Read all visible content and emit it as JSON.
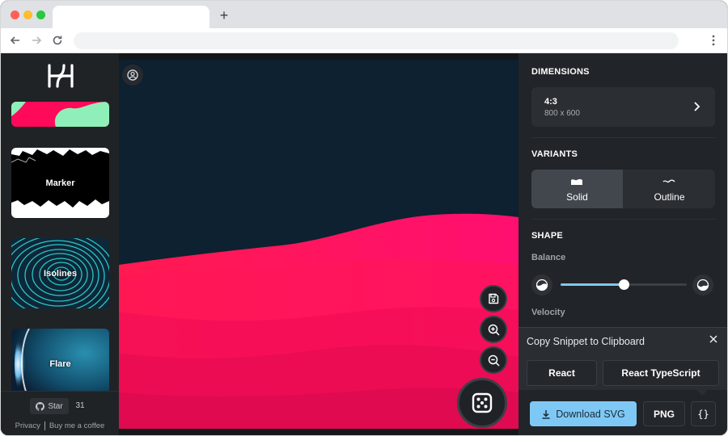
{
  "browser": {
    "new_tab_icon": "plus-icon",
    "back_icon": "arrow-left-icon",
    "forward_icon": "arrow-right-icon",
    "reload_icon": "reload-icon",
    "menu_icon": "kebab-menu-icon"
  },
  "sidebar": {
    "logo_icon": "haikei-logo-icon",
    "items": [
      {
        "label": "",
        "id": "blob"
      },
      {
        "label": "Marker",
        "id": "marker"
      },
      {
        "label": "Isolines",
        "id": "isolines"
      },
      {
        "label": "Flare",
        "id": "flare"
      }
    ],
    "footer": {
      "star_label": "Star",
      "star_count": "31",
      "privacy_link": "Privacy",
      "coffee_link": "Buy me a coffee"
    }
  },
  "canvas": {
    "background_color": "#0d2130",
    "wave_color": "#ff0a5a",
    "controls": {
      "save_icon": "save-icon",
      "zoom_in_icon": "zoom-in-icon",
      "zoom_out_icon": "zoom-out-icon",
      "random_icon": "dice-icon"
    }
  },
  "panel": {
    "dimensions": {
      "title": "DIMENSIONS",
      "ratio": "4:3",
      "size": "800 x 600"
    },
    "variants": {
      "title": "VARIANTS",
      "options": [
        {
          "label": "Solid",
          "selected": true
        },
        {
          "label": "Outline",
          "selected": false
        }
      ]
    },
    "shape": {
      "title": "SHAPE",
      "balance_label": "Balance",
      "balance_value": 0.5,
      "velocity_label": "Velocity"
    },
    "snippet_popup": {
      "title": "Copy Snippet to Clipboard",
      "close_icon": "close-icon",
      "react_label": "React",
      "react_ts_label": "React TypeScript"
    },
    "export": {
      "download_label": "Download SVG",
      "png_label": "PNG",
      "code_label": "{}"
    },
    "accent_color": "#7ec8f5"
  }
}
